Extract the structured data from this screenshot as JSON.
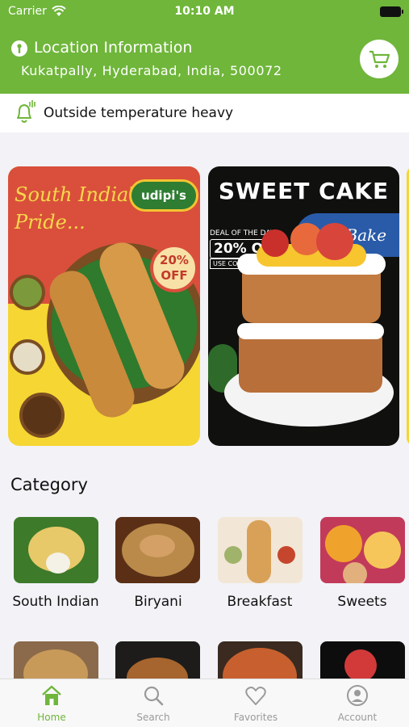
{
  "status_bar": {
    "carrier": "Carrier",
    "time": "10:10 AM"
  },
  "header": {
    "title": "Location Information",
    "address": "Kukatpally, Hyderabad, India, 500072",
    "cart_icon": "cart-icon"
  },
  "notice": {
    "text": "Outside temperature heavy",
    "icon": "bell-icon"
  },
  "banners": [
    {
      "name": "udipis-dosa-banner",
      "headline": "South India's Pride...",
      "brand": "udipi's",
      "offer": "20% OFF"
    },
    {
      "name": "sweet-cake-banner",
      "headline": "SWEET CAKE",
      "brand": "Just Bake",
      "deal_label": "DEAL OF THE DAY",
      "deal_offer": "20% OFF",
      "deal_code": "USE CODE : BAKE20"
    }
  ],
  "category": {
    "title": "Category",
    "items": [
      {
        "label": "South Indian"
      },
      {
        "label": "Biryani"
      },
      {
        "label": "Breakfast"
      },
      {
        "label": "Sweets"
      }
    ]
  },
  "tabbar": {
    "items": [
      {
        "label": "Home",
        "icon": "home-icon",
        "active": true
      },
      {
        "label": "Search",
        "icon": "search-icon",
        "active": false
      },
      {
        "label": "Favorites",
        "icon": "heart-icon",
        "active": false
      },
      {
        "label": "Account",
        "icon": "account-icon",
        "active": false
      }
    ]
  },
  "colors": {
    "brand_green": "#6fb63a",
    "inactive_gray": "#9a9a9a"
  }
}
